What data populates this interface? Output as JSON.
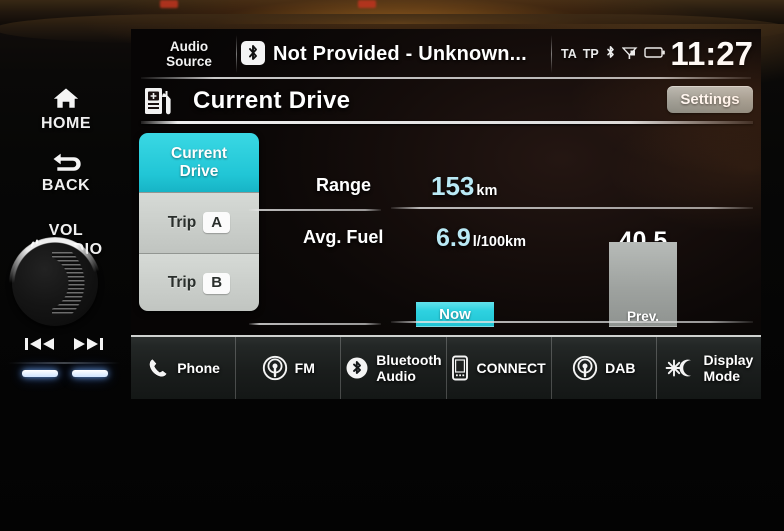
{
  "status_bar": {
    "audio_source_line1": "Audio",
    "audio_source_line2": "Source",
    "bluetooth_icon": "bluetooth-icon",
    "track_title": "Not Provided - Unknown...",
    "ta_label": "TA",
    "tp_label": "TP",
    "bt_status_icon": "bluetooth-icon",
    "signal_icon": "signal-bars-icon",
    "battery_icon": "battery-icon",
    "clock": "11:27"
  },
  "title_bar": {
    "fuel_icon": "fuel-pump-icon",
    "title": "Current Drive",
    "settings_label": "Settings"
  },
  "tabs": [
    {
      "label_line1": "Current",
      "label_line2": "Drive",
      "badge": "",
      "active": true
    },
    {
      "label_line1": "Trip",
      "label_line2": "",
      "badge": "A",
      "active": false
    },
    {
      "label_line1": "Trip",
      "label_line2": "",
      "badge": "B",
      "active": false
    }
  ],
  "readouts": [
    {
      "label": "Range",
      "value": "153",
      "unit": "km"
    },
    {
      "label": "Avg. Fuel",
      "value": "6.9",
      "unit": "l/100km"
    }
  ],
  "chart_data": {
    "type": "bar",
    "title": "Avg. Fuel",
    "categories": [
      "Now",
      "Prev."
    ],
    "values": [
      12.5,
      40.5
    ],
    "value_labels": [
      "",
      "40.5"
    ],
    "colors": [
      "#2ed2e0",
      "#9ea29f"
    ],
    "xlabel": "",
    "ylabel": "",
    "ylim": [
      0,
      100
    ],
    "grid": false,
    "legend": "none"
  },
  "bottom_bar": [
    {
      "icon": "phone-handset-icon",
      "label_line1": "Phone",
      "label_line2": ""
    },
    {
      "icon": "radio-broadcast-icon",
      "label_line1": "FM",
      "label_line2": ""
    },
    {
      "icon": "bluetooth-icon",
      "label_line1": "Bluetooth",
      "label_line2": "Audio"
    },
    {
      "icon": "smartphone-icon",
      "label_line1": "CONNECT",
      "label_line2": ""
    },
    {
      "icon": "radio-broadcast-icon",
      "label_line1": "DAB",
      "label_line2": ""
    },
    {
      "icon": "sun-moon-icon",
      "label_line1": "Display",
      "label_line2": "Mode"
    }
  ],
  "hard_buttons": {
    "home": {
      "icon": "home-icon",
      "label": "HOME"
    },
    "back": {
      "icon": "back-arrow-icon",
      "label": "BACK"
    },
    "volume": {
      "line1": "VOL",
      "power_icon": "power-icon",
      "line2": "AUDIO"
    },
    "prev_track": {
      "icon": "previous-track-icon"
    },
    "next_track": {
      "icon": "next-track-icon"
    }
  },
  "colors": {
    "accent_cyan": "#2ed2e0",
    "value_cyan": "#b9e9f5",
    "tab_idle": "#c9cdc9",
    "bar_prev": "#9ea29f"
  }
}
